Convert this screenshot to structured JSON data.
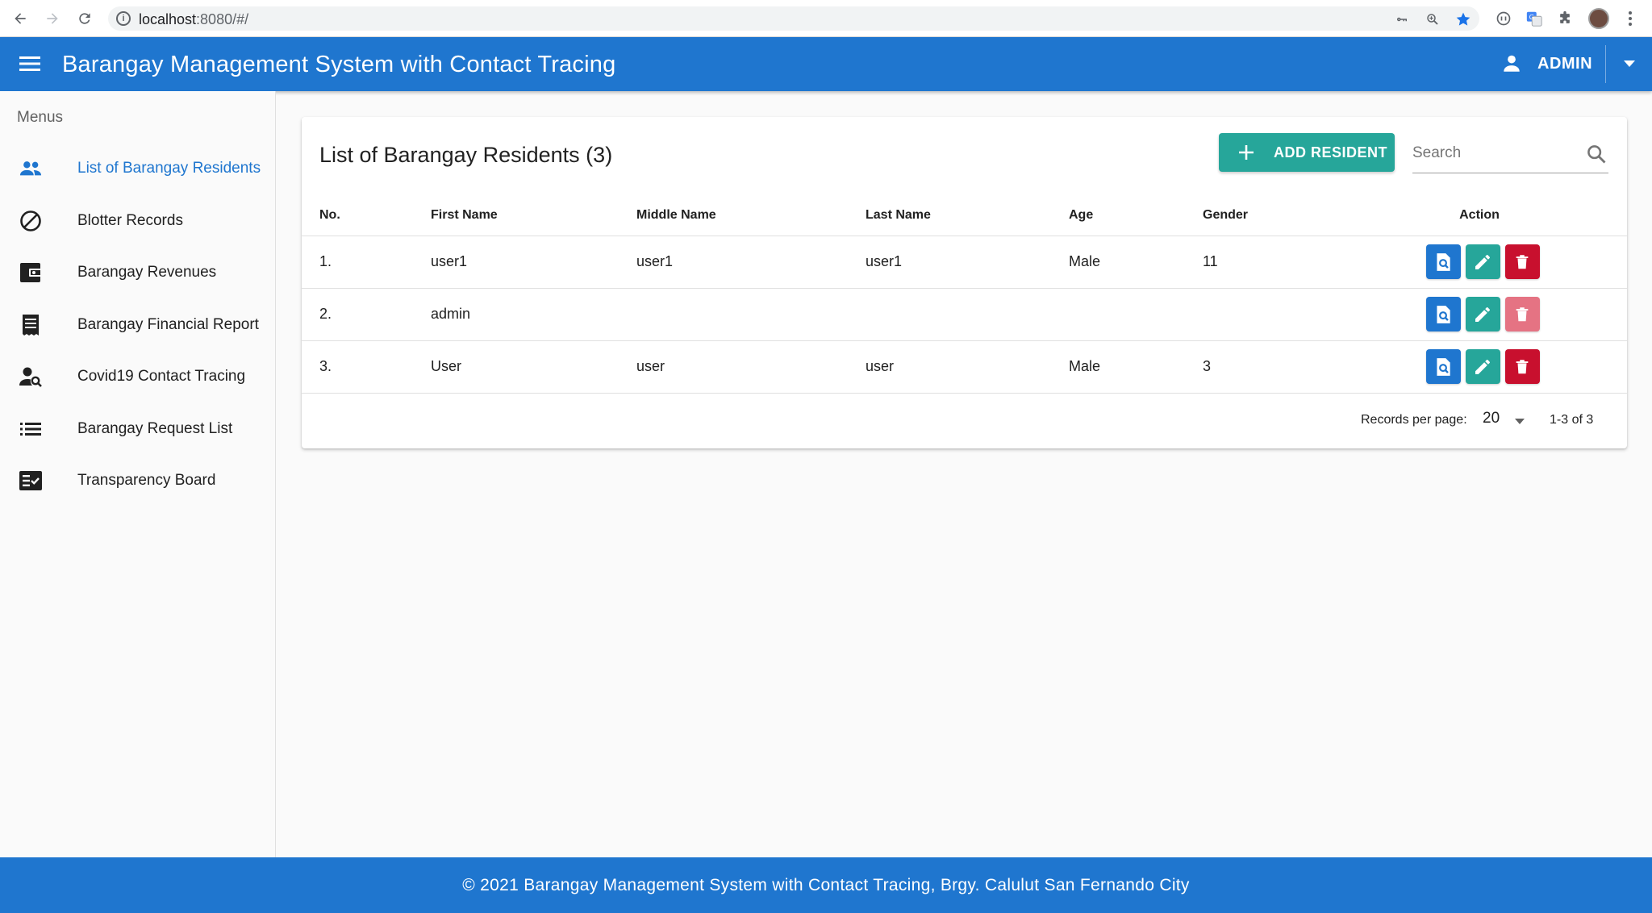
{
  "browser": {
    "url_host": "localhost",
    "url_rest": ":8080/#/"
  },
  "app": {
    "title": "Barangay Management System with Contact Tracing",
    "user": "ADMIN",
    "primary_color": "#1f76cf",
    "accent_color": "#26a69a",
    "danger_color": "#c8102e"
  },
  "sidebar": {
    "heading": "Menus",
    "items": [
      {
        "label": "List of Barangay Residents",
        "icon": "people-icon",
        "active": true
      },
      {
        "label": "Blotter Records",
        "icon": "block-icon"
      },
      {
        "label": "Barangay Revenues",
        "icon": "wallet-icon"
      },
      {
        "label": "Barangay Financial Report",
        "icon": "receipt-icon"
      },
      {
        "label": "Covid19 Contact Tracing",
        "icon": "person-search-icon"
      },
      {
        "label": "Barangay Request List",
        "icon": "list-icon"
      },
      {
        "label": "Transparency Board",
        "icon": "fact-check-icon"
      }
    ]
  },
  "card": {
    "title": "List of Barangay Residents (3)",
    "add_label": "ADD RESIDENT",
    "search_placeholder": "Search"
  },
  "table": {
    "headers": [
      "No.",
      "First Name",
      "Middle Name",
      "Last Name",
      "Age",
      "Gender",
      "Action"
    ],
    "rows": [
      {
        "no": "1.",
        "first": "user1",
        "middle": "user1",
        "last": "user1",
        "age": "Male",
        "gender": "11",
        "delete_enabled": true
      },
      {
        "no": "2.",
        "first": "admin",
        "middle": "",
        "last": "",
        "age": "",
        "gender": "",
        "delete_enabled": false
      },
      {
        "no": "3.",
        "first": "User",
        "middle": "user",
        "last": "user",
        "age": "Male",
        "gender": "3",
        "delete_enabled": true
      }
    ]
  },
  "pagination": {
    "rows_per_page_label": "Records per page:",
    "rows_per_page": "20",
    "range": "1-3 of 3"
  },
  "footer": {
    "text": "© 2021 Barangay Management System with Contact Tracing, Brgy. Calulut San Fernando City"
  }
}
